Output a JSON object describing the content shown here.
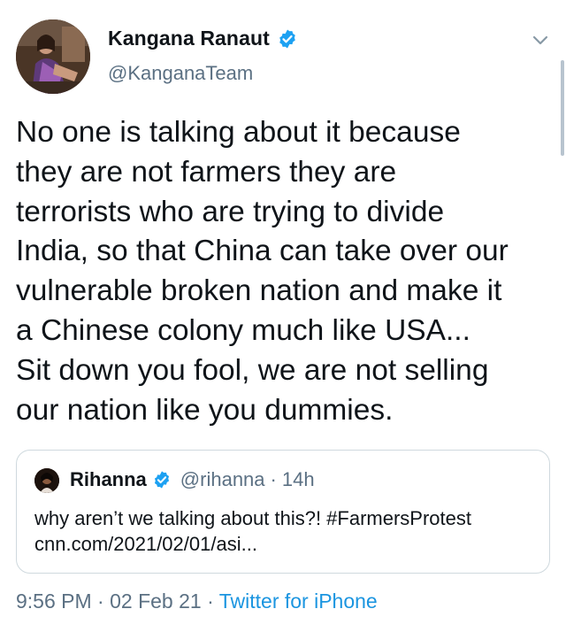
{
  "author": {
    "name": "Kangana Ranaut",
    "handle": "@KanganaTeam",
    "verified": true,
    "avatar_icon": "profile-photo"
  },
  "tweet": {
    "lines": [
      "No one is talking about it because",
      "they are not farmers they are",
      "terrorists who are trying to divide",
      "India, so that China can take over our",
      "vulnerable broken nation and make it",
      "a Chinese colony much like USA...",
      "Sit down you fool, we are not selling",
      "our nation like you dummies."
    ]
  },
  "quoted_tweet": {
    "name": "Rihanna",
    "handle": "@rihanna",
    "separator": "·",
    "time": "14h",
    "verified": true,
    "lines": [
      "why aren’t we talking about this?! #FarmersProtest",
      "cnn.com/2021/02/01/asi..."
    ]
  },
  "meta": {
    "time": "9:56 PM",
    "sep1": "·",
    "date": "02 Feb 21",
    "sep2": "·",
    "app": "Twitter for iPhone"
  },
  "colors": {
    "text": "#0f1419",
    "secondary": "#5b7083",
    "link": "#1b95e0",
    "verified": "#1da1f2",
    "border": "#cfd9de"
  },
  "icons": {
    "verified": "verified-badge-icon",
    "more": "chevron-down-icon"
  }
}
